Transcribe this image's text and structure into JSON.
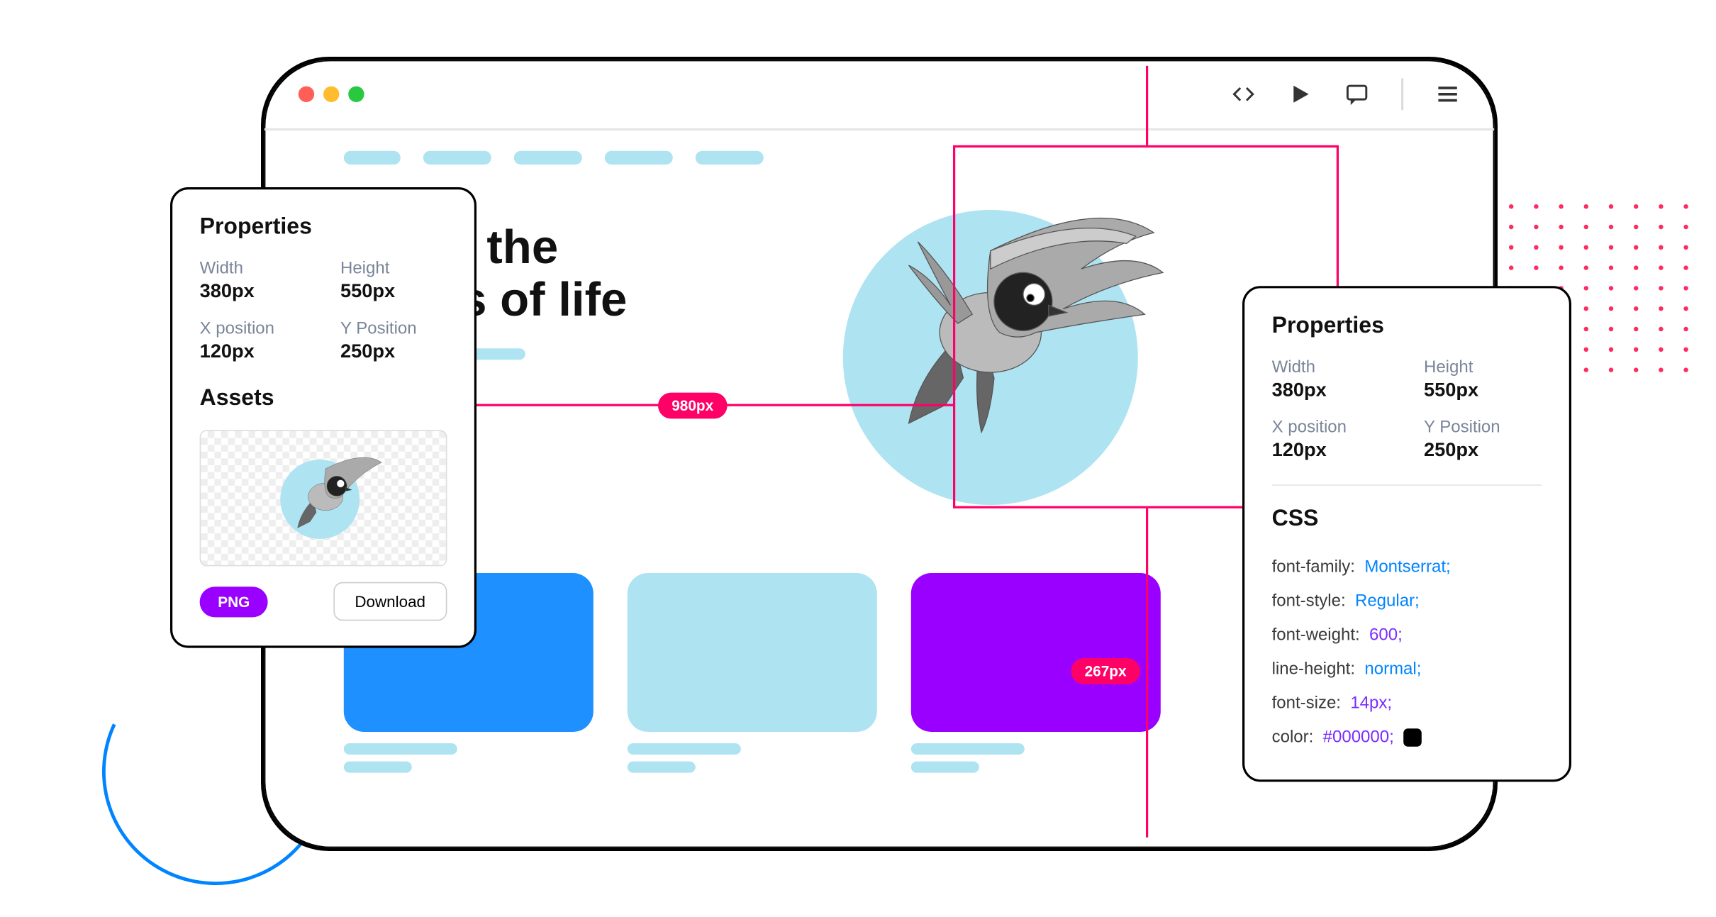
{
  "hero": {
    "title_line1": "Enjoy the",
    "title_line2": "colors of life"
  },
  "measurements": {
    "width_label": "980px",
    "height_label": "267px"
  },
  "left_panel": {
    "properties_title": "Properties",
    "width_label": "Width",
    "width_value": "380px",
    "height_label": "Height",
    "height_value": "550px",
    "xpos_label": "X position",
    "xpos_value": "120px",
    "ypos_label": "Y Position",
    "ypos_value": "250px",
    "assets_title": "Assets",
    "badge": "PNG",
    "download": "Download"
  },
  "right_panel": {
    "properties_title": "Properties",
    "width_label": "Width",
    "width_value": "380px",
    "height_label": "Height",
    "height_value": "550px",
    "xpos_label": "X position",
    "xpos_value": "120px",
    "ypos_label": "Y Position",
    "ypos_value": "250px",
    "css_title": "CSS",
    "css": {
      "font_family_key": "font-family:",
      "font_family_val": "Montserrat;",
      "font_style_key": "font-style:",
      "font_style_val": "Regular;",
      "font_weight_key": "font-weight:",
      "font_weight_val": "600;",
      "line_height_key": "line-height:",
      "line_height_val": "normal;",
      "font_size_key": "font-size:",
      "font_size_val": "14px;",
      "color_key": "color:",
      "color_val": "#000000;"
    }
  }
}
